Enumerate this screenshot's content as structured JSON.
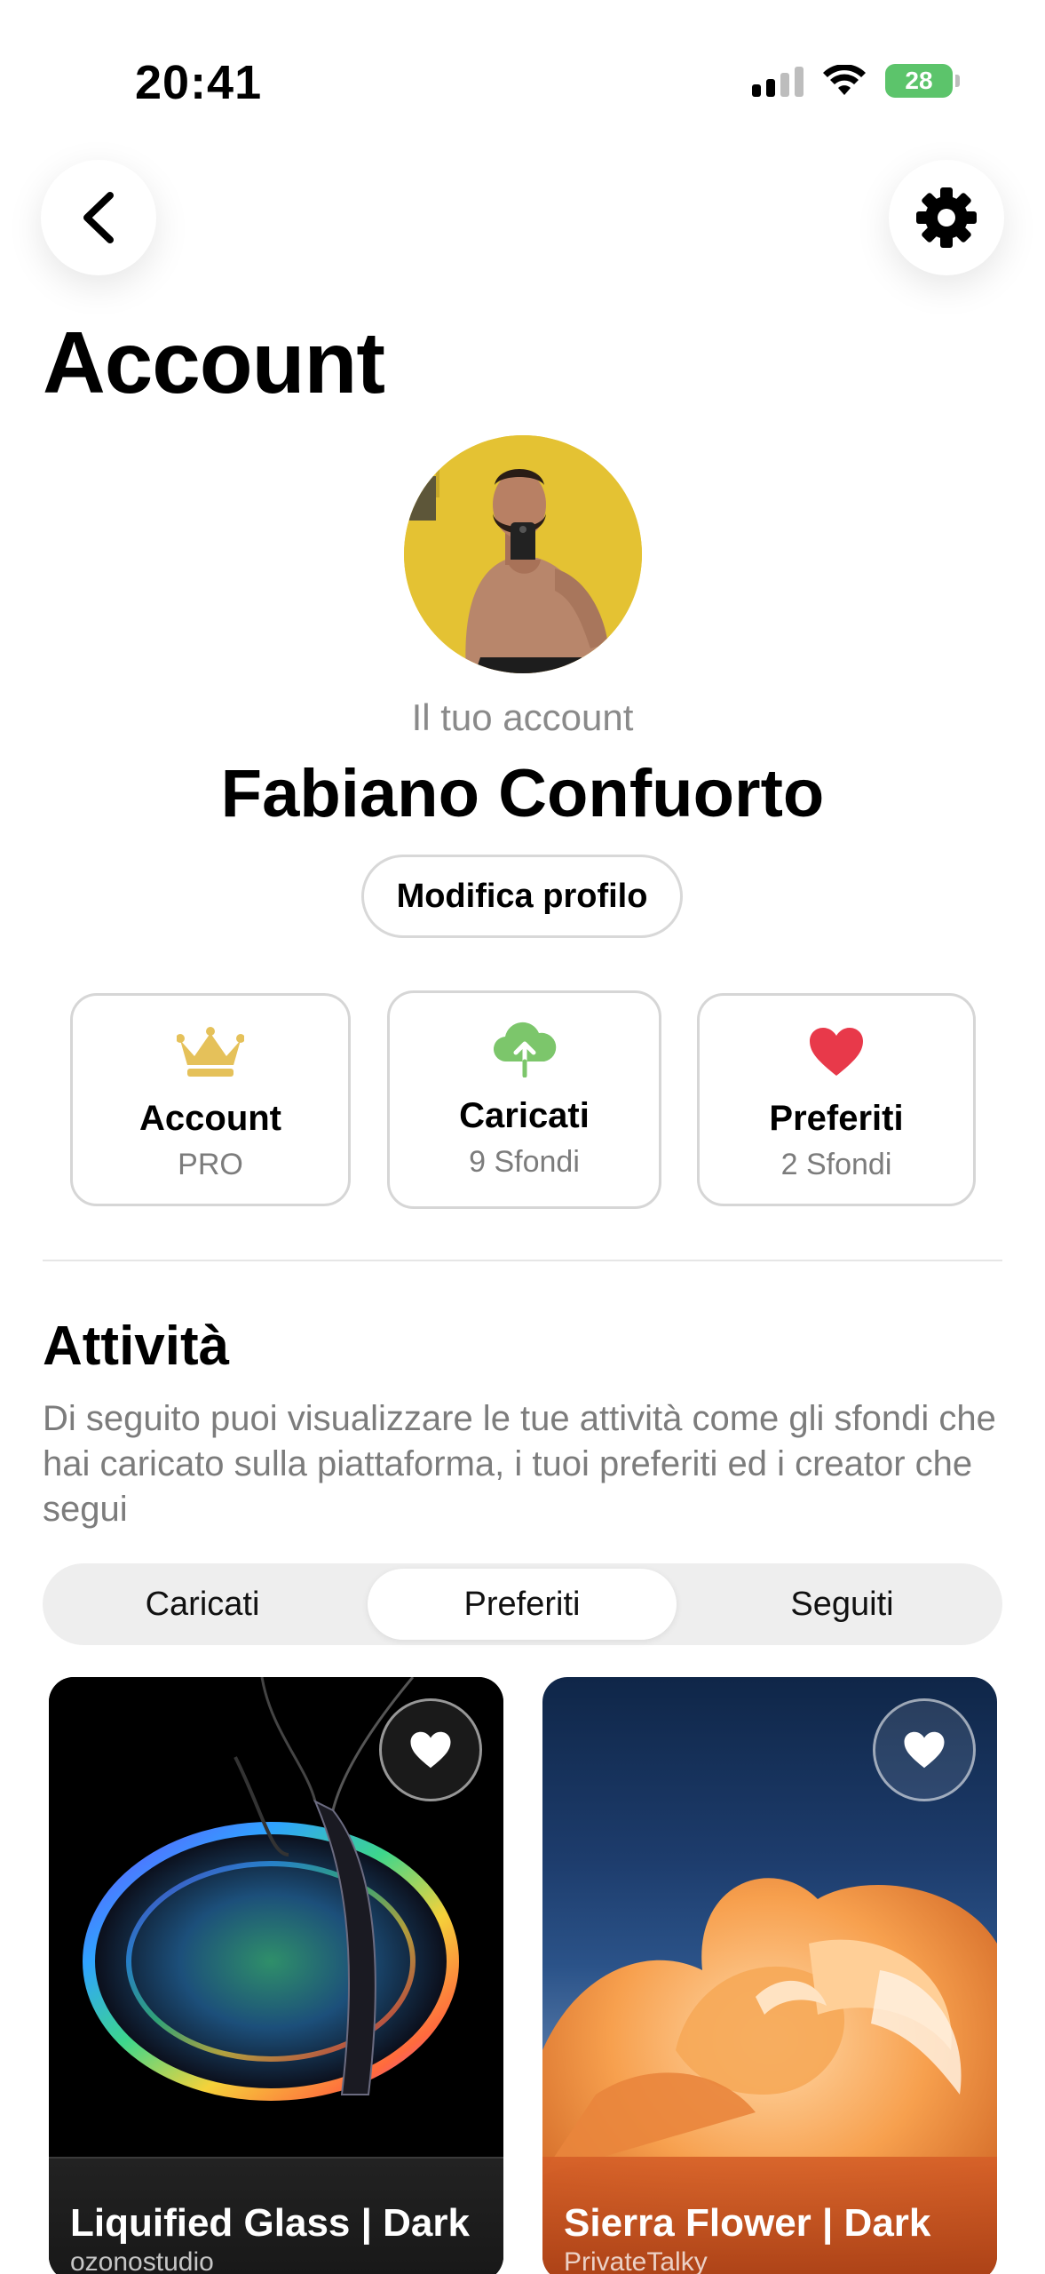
{
  "status": {
    "time": "20:41",
    "battery": "28"
  },
  "header": {
    "title": "Account"
  },
  "profile": {
    "caption": "Il tuo account",
    "name": "Fabiano Confuorto",
    "edit_label": "Modifica profilo"
  },
  "stats": [
    {
      "icon": "crown-icon",
      "title": "Account",
      "subtitle": "PRO",
      "color": "#e5c15a"
    },
    {
      "icon": "cloud-upload-icon",
      "title": "Caricati",
      "subtitle": "9 Sfondi",
      "color": "#7cc66b"
    },
    {
      "icon": "heart-icon",
      "title": "Preferiti",
      "subtitle": "2 Sfondi",
      "color": "#e8394a"
    }
  ],
  "activity": {
    "title": "Attività",
    "description": "Di seguito puoi visualizzare le tue attività come gli sfondi che hai caricato sulla piattaforma, i tuoi preferiti ed i creator che segui",
    "tabs": [
      {
        "label": "Caricati",
        "active": false
      },
      {
        "label": "Preferiti",
        "active": true
      },
      {
        "label": "Seguiti",
        "active": false
      }
    ]
  },
  "wallpapers": [
    {
      "title": "Liquified Glass | Dark",
      "author": "ozonostudio",
      "favorited": true
    },
    {
      "title": "Sierra Flower | Dark",
      "author": "PrivateTalky",
      "favorited": true
    }
  ]
}
